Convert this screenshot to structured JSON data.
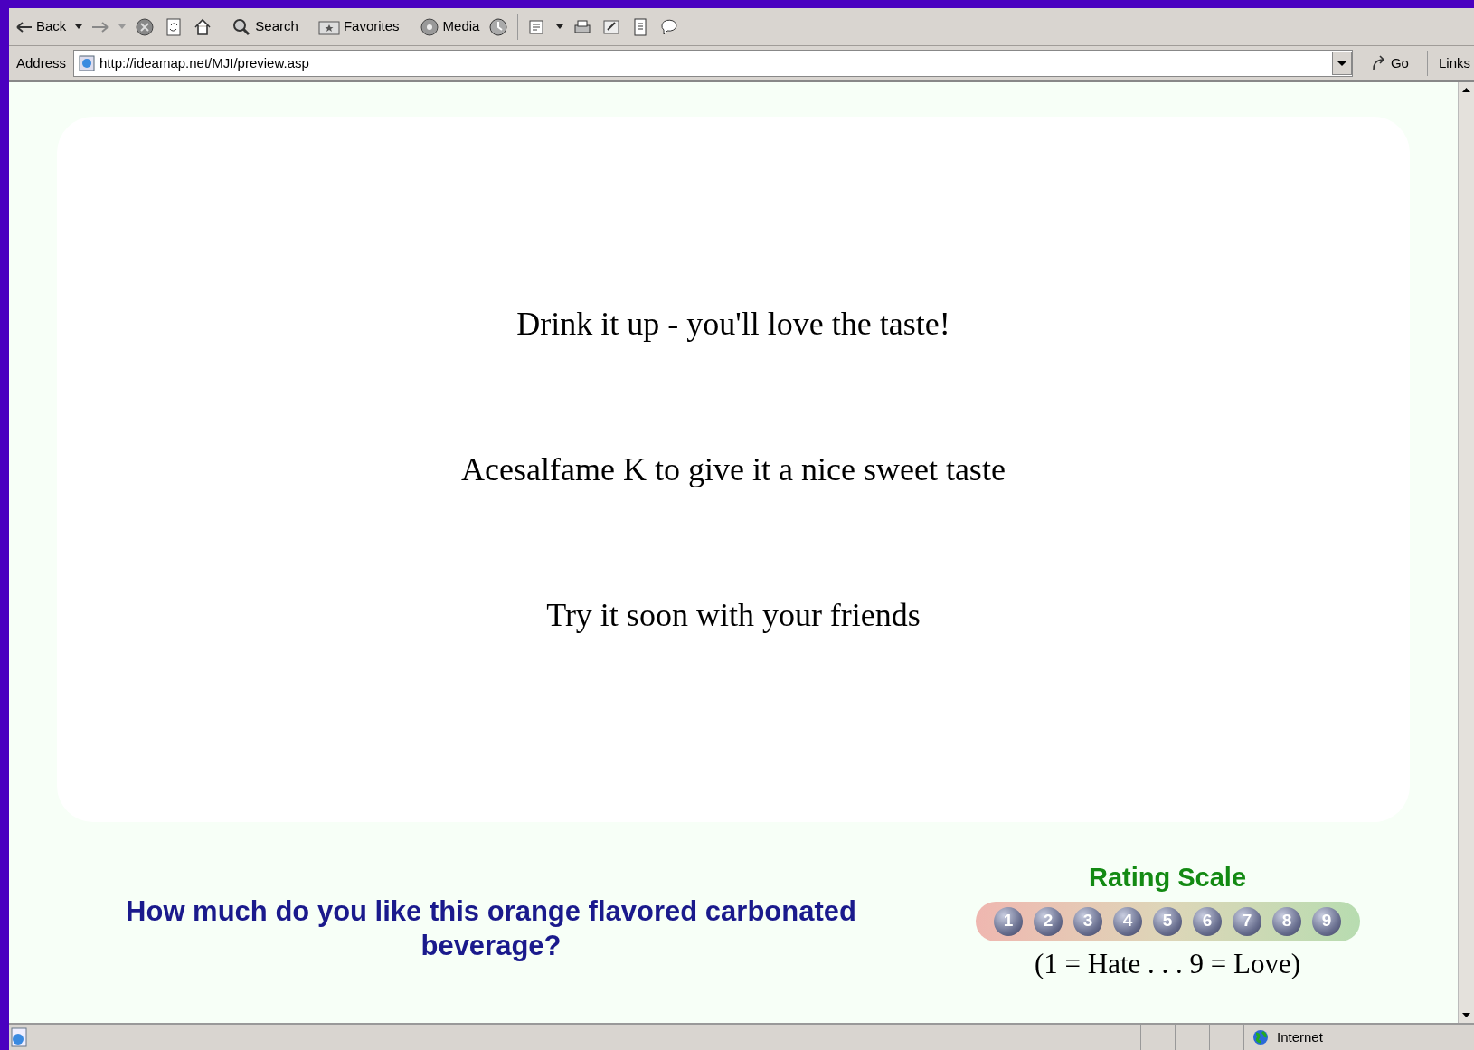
{
  "toolbar": {
    "back": "Back",
    "buttons": [
      "Search",
      "Favorites",
      "Media"
    ]
  },
  "address_bar": {
    "label": "Address",
    "url": "http://ideamap.net/MJI/preview.asp",
    "go": "Go",
    "links": "Links"
  },
  "card": {
    "lines": [
      "Drink it up - you'll love the taste!",
      "Acesalfame K to give it a nice sweet taste",
      "Try it soon with your friends"
    ]
  },
  "question": "How much do you like this orange flavored carbonated beverage?",
  "rating": {
    "title": "Rating Scale",
    "options": [
      "1",
      "2",
      "3",
      "4",
      "5",
      "6",
      "7",
      "8",
      "9"
    ],
    "legend": "(1 = Hate . . . 9 = Love)"
  },
  "status_bar": {
    "zone": "Internet"
  }
}
